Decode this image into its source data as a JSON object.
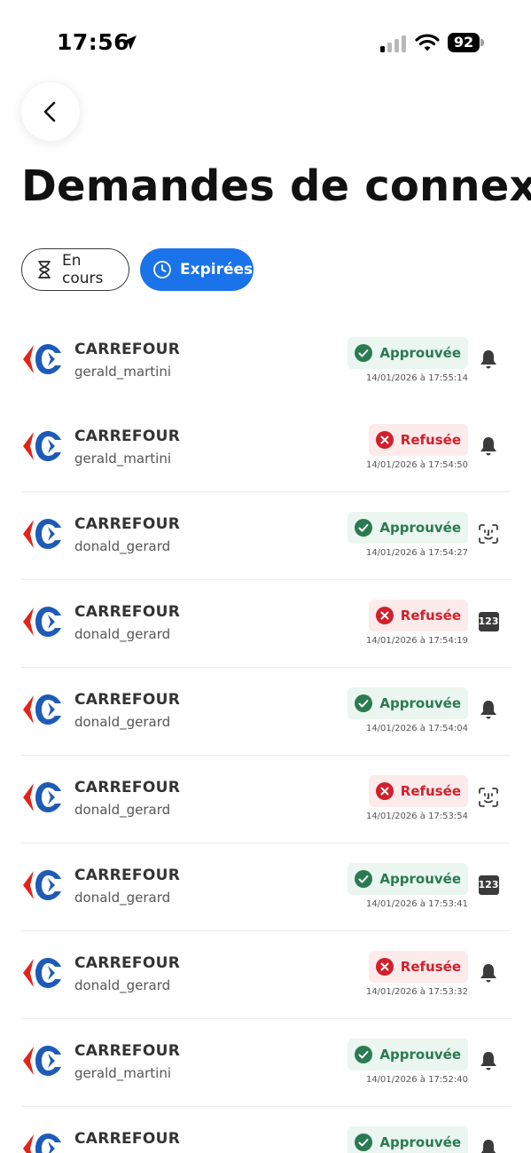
{
  "status_bar": {
    "time": "17:56",
    "battery": "92"
  },
  "header": {
    "title": "Demandes de connexion"
  },
  "filters": [
    {
      "label": "En cours",
      "active": false,
      "icon": "hourglass-icon"
    },
    {
      "label": "Expirées",
      "active": true,
      "icon": "clock-icon"
    }
  ],
  "colors": {
    "accent": "#1a73e8",
    "approved_bg": "#eaf6ef",
    "approved_text": "#2a7a52",
    "refused_bg": "#fdebec",
    "refused_text": "#d21f2b",
    "carrefour_blue": "#1e5bb8",
    "carrefour_red": "#e2231a"
  },
  "requests": [
    {
      "merchant": "CARREFOUR",
      "username": "gerald_martini",
      "status": "Approuvée",
      "status_type": "approved",
      "timestamp": "14/01/2026 à 17:55:14",
      "method": "bell-icon"
    },
    {
      "merchant": "CARREFOUR",
      "username": "gerald_martini",
      "status": "Refusée",
      "status_type": "refused",
      "timestamp": "14/01/2026 à 17:54:50",
      "method": "bell-icon"
    },
    {
      "merchant": "CARREFOUR",
      "username": "donald_gerard",
      "status": "Approuvée",
      "status_type": "approved",
      "timestamp": "14/01/2026 à 17:54:27",
      "method": "face-id-icon"
    },
    {
      "merchant": "CARREFOUR",
      "username": "donald_gerard",
      "status": "Refusée",
      "status_type": "refused",
      "timestamp": "14/01/2026 à 17:54:19",
      "method": "pin-icon",
      "pin_label": "123"
    },
    {
      "merchant": "CARREFOUR",
      "username": "donald_gerard",
      "status": "Approuvée",
      "status_type": "approved",
      "timestamp": "14/01/2026 à 17:54:04",
      "method": "bell-icon"
    },
    {
      "merchant": "CARREFOUR",
      "username": "donald_gerard",
      "status": "Refusée",
      "status_type": "refused",
      "timestamp": "14/01/2026 à 17:53:54",
      "method": "face-id-icon"
    },
    {
      "merchant": "CARREFOUR",
      "username": "donald_gerard",
      "status": "Approuvée",
      "status_type": "approved",
      "timestamp": "14/01/2026 à 17:53:41",
      "method": "pin-icon",
      "pin_label": "123"
    },
    {
      "merchant": "CARREFOUR",
      "username": "donald_gerard",
      "status": "Refusée",
      "status_type": "refused",
      "timestamp": "14/01/2026 à 17:53:32",
      "method": "bell-icon"
    },
    {
      "merchant": "CARREFOUR",
      "username": "gerald_martini",
      "status": "Approuvée",
      "status_type": "approved",
      "timestamp": "14/01/2026 à 17:52:40",
      "method": "bell-icon"
    },
    {
      "merchant": "CARREFOUR",
      "username": "",
      "status": "Approuvée",
      "status_type": "approved",
      "timestamp": "",
      "method": "bell-icon"
    }
  ]
}
